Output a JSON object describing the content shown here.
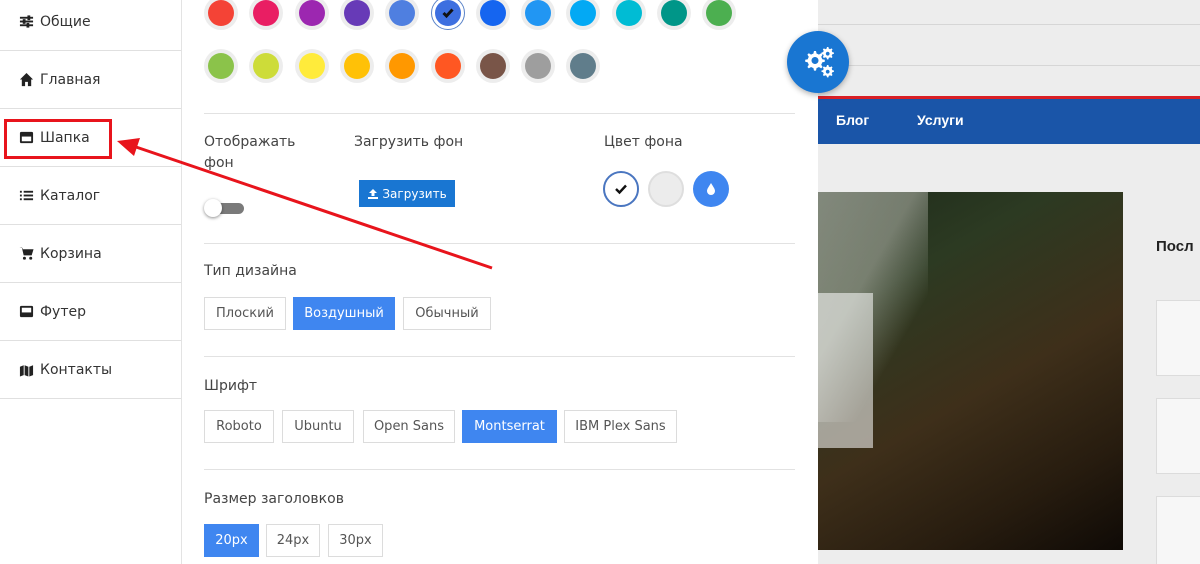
{
  "sidebar": {
    "items": [
      {
        "label": "Общие",
        "icon": "sliders-icon"
      },
      {
        "label": "Главная",
        "icon": "home-icon"
      },
      {
        "label": "Шапка",
        "icon": "header-icon"
      },
      {
        "label": "Каталог",
        "icon": "list-icon"
      },
      {
        "label": "Корзина",
        "icon": "cart-icon"
      },
      {
        "label": "Футер",
        "icon": "footer-icon"
      },
      {
        "label": "Контакты",
        "icon": "map-icon"
      }
    ],
    "highlighted": "Шапка"
  },
  "colors": {
    "row1": [
      "#f44336",
      "#e91e63",
      "#9c27b0",
      "#673ab7",
      "#4f7fe0",
      "#3d6fe0",
      "#1565f0",
      "#2196f3",
      "#03a9f4",
      "#00bcd4",
      "#009688",
      "#4caf50"
    ],
    "row2": [
      "#8bc34a",
      "#cddc39",
      "#ffeb3b",
      "#ffc107",
      "#ff9800",
      "#ff5722",
      "#795548",
      "#9e9e9e",
      "#607d8b"
    ],
    "selected_index": 5,
    "accent": "#3f86f0",
    "annotation": "#e8141c"
  },
  "header_settings": {
    "show_bg_label": "Отображать фон",
    "upload_bg_label": "Загрузить фон",
    "upload_button": "Загрузить",
    "bg_color_label": "Цвет фона",
    "show_bg_enabled": false
  },
  "design_type": {
    "label": "Тип дизайна",
    "options": [
      "Плоский",
      "Воздушный",
      "Обычный"
    ],
    "selected": "Воздушный"
  },
  "font": {
    "label": "Шрифт",
    "options": [
      "Roboto",
      "Ubuntu",
      "Open Sans",
      "Montserrat",
      "IBM Plex Sans"
    ],
    "selected": "Montserrat"
  },
  "heading_size": {
    "label": "Размер заголовков",
    "options": [
      "20px",
      "24px",
      "30px"
    ],
    "selected": "20px"
  },
  "preview": {
    "nav": [
      "Блог",
      "Услуги"
    ],
    "heading": "Посл"
  }
}
